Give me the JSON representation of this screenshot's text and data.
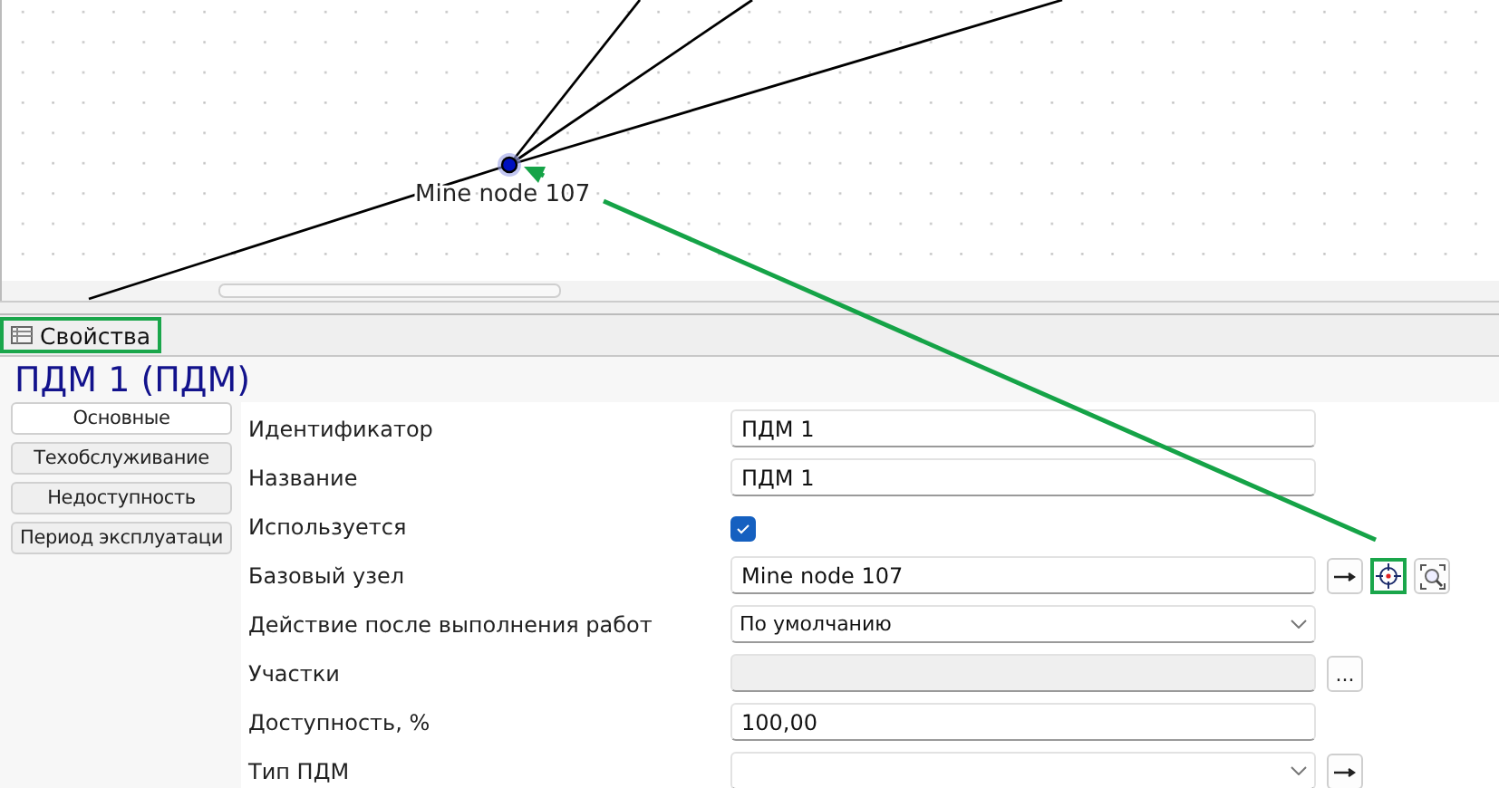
{
  "canvas": {
    "node": {
      "label": "Mine node 107",
      "selected": true
    }
  },
  "panel": {
    "title": "Свойства",
    "highlighted": true
  },
  "object_title": "ПДМ 1 (ПДМ)",
  "tabs": [
    {
      "label": "Основные",
      "selected": true
    },
    {
      "label": "Техобслуживание",
      "selected": false
    },
    {
      "label": "Недоступность",
      "selected": false
    },
    {
      "label": "Период эксплуатаци",
      "selected": false
    }
  ],
  "properties": [
    {
      "label": "Идентификатор",
      "kind": "text",
      "value": "ПДМ 1"
    },
    {
      "label": "Название",
      "kind": "text",
      "value": "ПДМ 1"
    },
    {
      "label": "Используется",
      "kind": "checkbox",
      "checked": true
    },
    {
      "label": "Базовый узел",
      "kind": "text",
      "value": "Mine node 107",
      "buttons": [
        {
          "kind": "goto",
          "highlighted": false
        },
        {
          "kind": "locate",
          "highlighted": true
        },
        {
          "kind": "zoom",
          "highlighted": false
        }
      ]
    },
    {
      "label": "Действие после выполнения работ",
      "kind": "combo",
      "value": "По умолчанию"
    },
    {
      "label": "Участки",
      "kind": "readonly",
      "buttons": [
        {
          "kind": "more",
          "text": "...",
          "highlighted": false
        }
      ]
    },
    {
      "label": "Доступность, %",
      "kind": "text",
      "value": "100,00"
    },
    {
      "label": "Тип ПДМ",
      "kind": "combo",
      "buttons": [
        {
          "kind": "goto",
          "highlighted": false
        }
      ]
    }
  ]
}
